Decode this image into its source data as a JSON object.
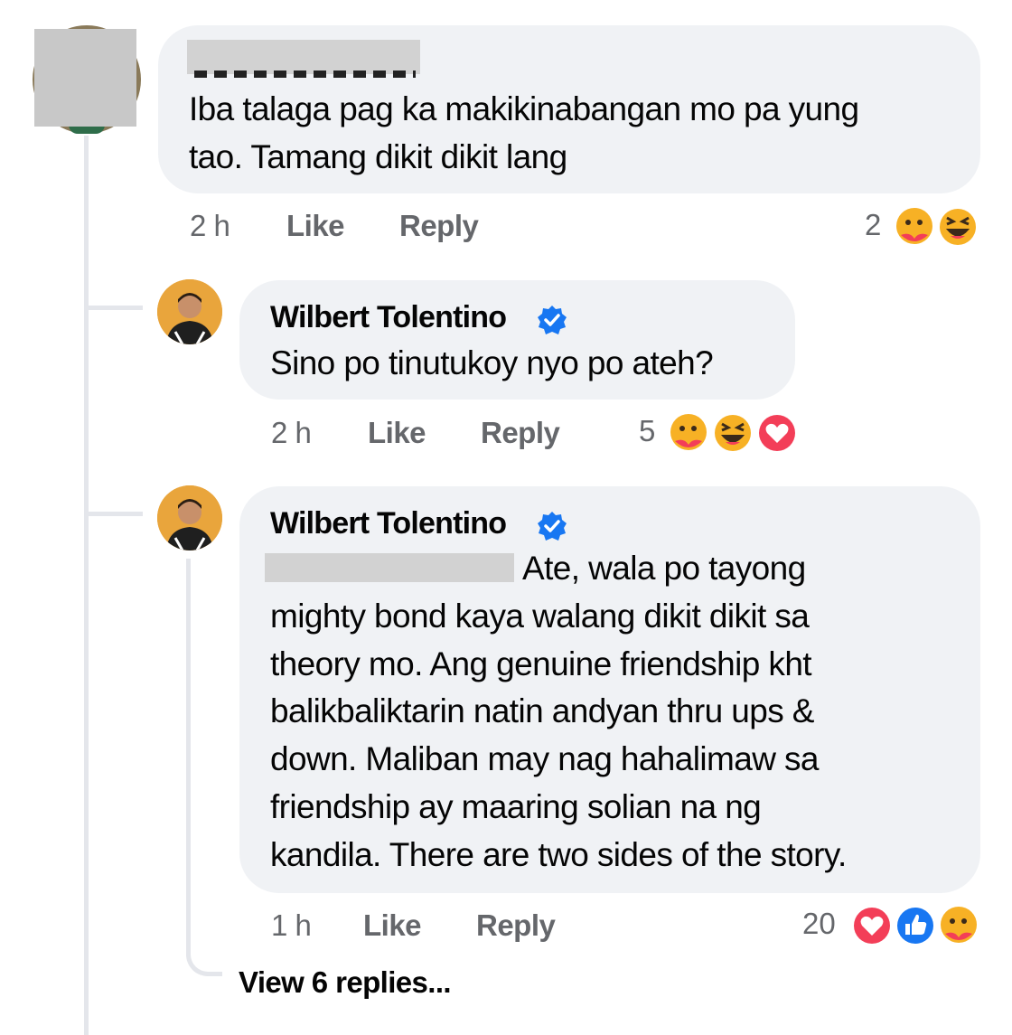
{
  "comment1": {
    "text_line1": "Iba talaga pag ka makikinabangan mo pa yung",
    "text_line2": "tao. Tamang dikit dikit lang",
    "time": "2 h",
    "like_label": "Like",
    "reply_label": "Reply",
    "reaction_count": "2",
    "reactions": [
      "care-reaction-icon",
      "haha-reaction-icon"
    ]
  },
  "reply1": {
    "author": "Wilbert Tolentino",
    "verified_icon": "verified-badge-icon",
    "text": "Sino po tinutukoy nyo po ateh?",
    "time": "2 h",
    "like_label": "Like",
    "reply_label": "Reply",
    "reaction_count": "5",
    "reactions": [
      "care-reaction-icon",
      "haha-reaction-icon",
      "love-reaction-icon"
    ]
  },
  "reply2": {
    "author": "Wilbert Tolentino",
    "verified_icon": "verified-badge-icon",
    "line1": "Ate, wala po tayong",
    "line2": "mighty bond kaya walang dikit dikit sa",
    "line3": "theory mo. Ang genuine friendship kht",
    "line4": "balikbaliktarin natin andyan thru ups &",
    "line5": "down. Maliban may nag hahalimaw sa",
    "line6": "friendship ay maaring solian na ng",
    "line7": "kandila. There are two sides of the story.",
    "time": "1 h",
    "like_label": "Like",
    "reply_label": "Reply",
    "reaction_count": "20",
    "reactions": [
      "love-reaction-icon",
      "like-reaction-icon",
      "care-reaction-icon"
    ]
  },
  "view_replies": "View 6 replies...",
  "colors": {
    "bubble": "#f0f2f5",
    "meta_text": "#65676b",
    "verified": "#1877f2",
    "love": "#f33e58",
    "like": "#1877f2",
    "emoji_yellow": "#f7b125"
  }
}
